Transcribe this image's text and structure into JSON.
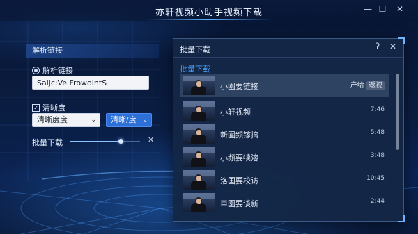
{
  "window": {
    "title": "亦轩视频小助手视频下载",
    "minimize_icon": "minimize-icon",
    "maximize_icon": "maximize-icon",
    "close_icon": "close-icon",
    "minimize_glyph": "—",
    "maximize_glyph": "☐",
    "close_glyph": "✕"
  },
  "left_panel": {
    "header": "解析链接",
    "link_label": "解析链接",
    "link_value": "Saijc:Ve FrowolntS",
    "quality_label": "清晰度",
    "quality_select": "清晰度度",
    "quality_button": "清晰/度",
    "batch_label": "批量下载",
    "batch_progress": 0.72,
    "batch_close": "✕",
    "caret": "⌄"
  },
  "dialog": {
    "title": "批量下载",
    "help_icon": "help-icon",
    "help_glyph": "ʔ",
    "close_glyph": "✕",
    "subtitle": "批量下载",
    "items": [
      {
        "title": "小園要链接",
        "action_1": "产给",
        "action_2": "返视",
        "selected": true
      },
      {
        "title": "小轩视频",
        "duration": "7:46"
      },
      {
        "title": "新圍频镓搞",
        "duration": "5:48"
      },
      {
        "title": "小频要犊溶",
        "duration": "3:48"
      },
      {
        "title": "洛国要校访",
        "duration": "10:45"
      },
      {
        "title": "車園要谈新",
        "duration": "2:44"
      }
    ]
  },
  "colors": {
    "accent": "#2c6fd6",
    "link_blue": "#4ea3ff",
    "background": "#0a1c40"
  }
}
